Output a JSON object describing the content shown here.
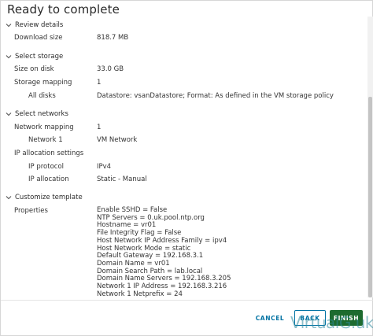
{
  "window": {
    "title": "Ready to complete"
  },
  "sections": {
    "review": {
      "title": "Review details",
      "rows": [
        {
          "label": "Download size",
          "value": "818.7 MB"
        }
      ]
    },
    "storage": {
      "title": "Select storage",
      "rows": [
        {
          "label": "Size on disk",
          "value": "33.0 GB"
        },
        {
          "label": "Storage mapping",
          "value": "1"
        },
        {
          "label": "All disks",
          "value": "Datastore: vsanDatastore; Format: As defined in the VM storage policy"
        }
      ]
    },
    "networks": {
      "title": "Select networks",
      "rows": [
        {
          "label": "Network mapping",
          "value": "1"
        },
        {
          "label": "Network 1",
          "value": "VM Network"
        },
        {
          "label": "IP allocation settings",
          "value": ""
        },
        {
          "label": "IP protocol",
          "value": "IPv4"
        },
        {
          "label": "IP allocation",
          "value": "Static - Manual"
        }
      ]
    },
    "template": {
      "title": "Customize template",
      "properties_label": "Properties",
      "properties": [
        "Enable SSHD = False",
        "NTP Servers = 0.uk.pool.ntp.org",
        "Hostname = vr01",
        "File Integrity Flag = False",
        "Host Network IP Address Family = ipv4",
        "Host Network Mode = static",
        "Default Gateway = 192.168.3.1",
        "Domain Name = vr01",
        "Domain Search Path = lab.local",
        "Domain Name Servers = 192.168.3.205",
        "Network 1 IP Address = 192.168.3.216",
        "Network 1 Netprefix = 24"
      ]
    }
  },
  "footer": {
    "cancel_label": "CANCEL",
    "back_label": "BACK",
    "finish_label": "FINISH"
  },
  "watermark": "VirtualG.uk",
  "colors": {
    "link_blue": "#0072a3",
    "finish_green": "#1d6b2f",
    "watermark_teal": "#2f8a9e"
  }
}
